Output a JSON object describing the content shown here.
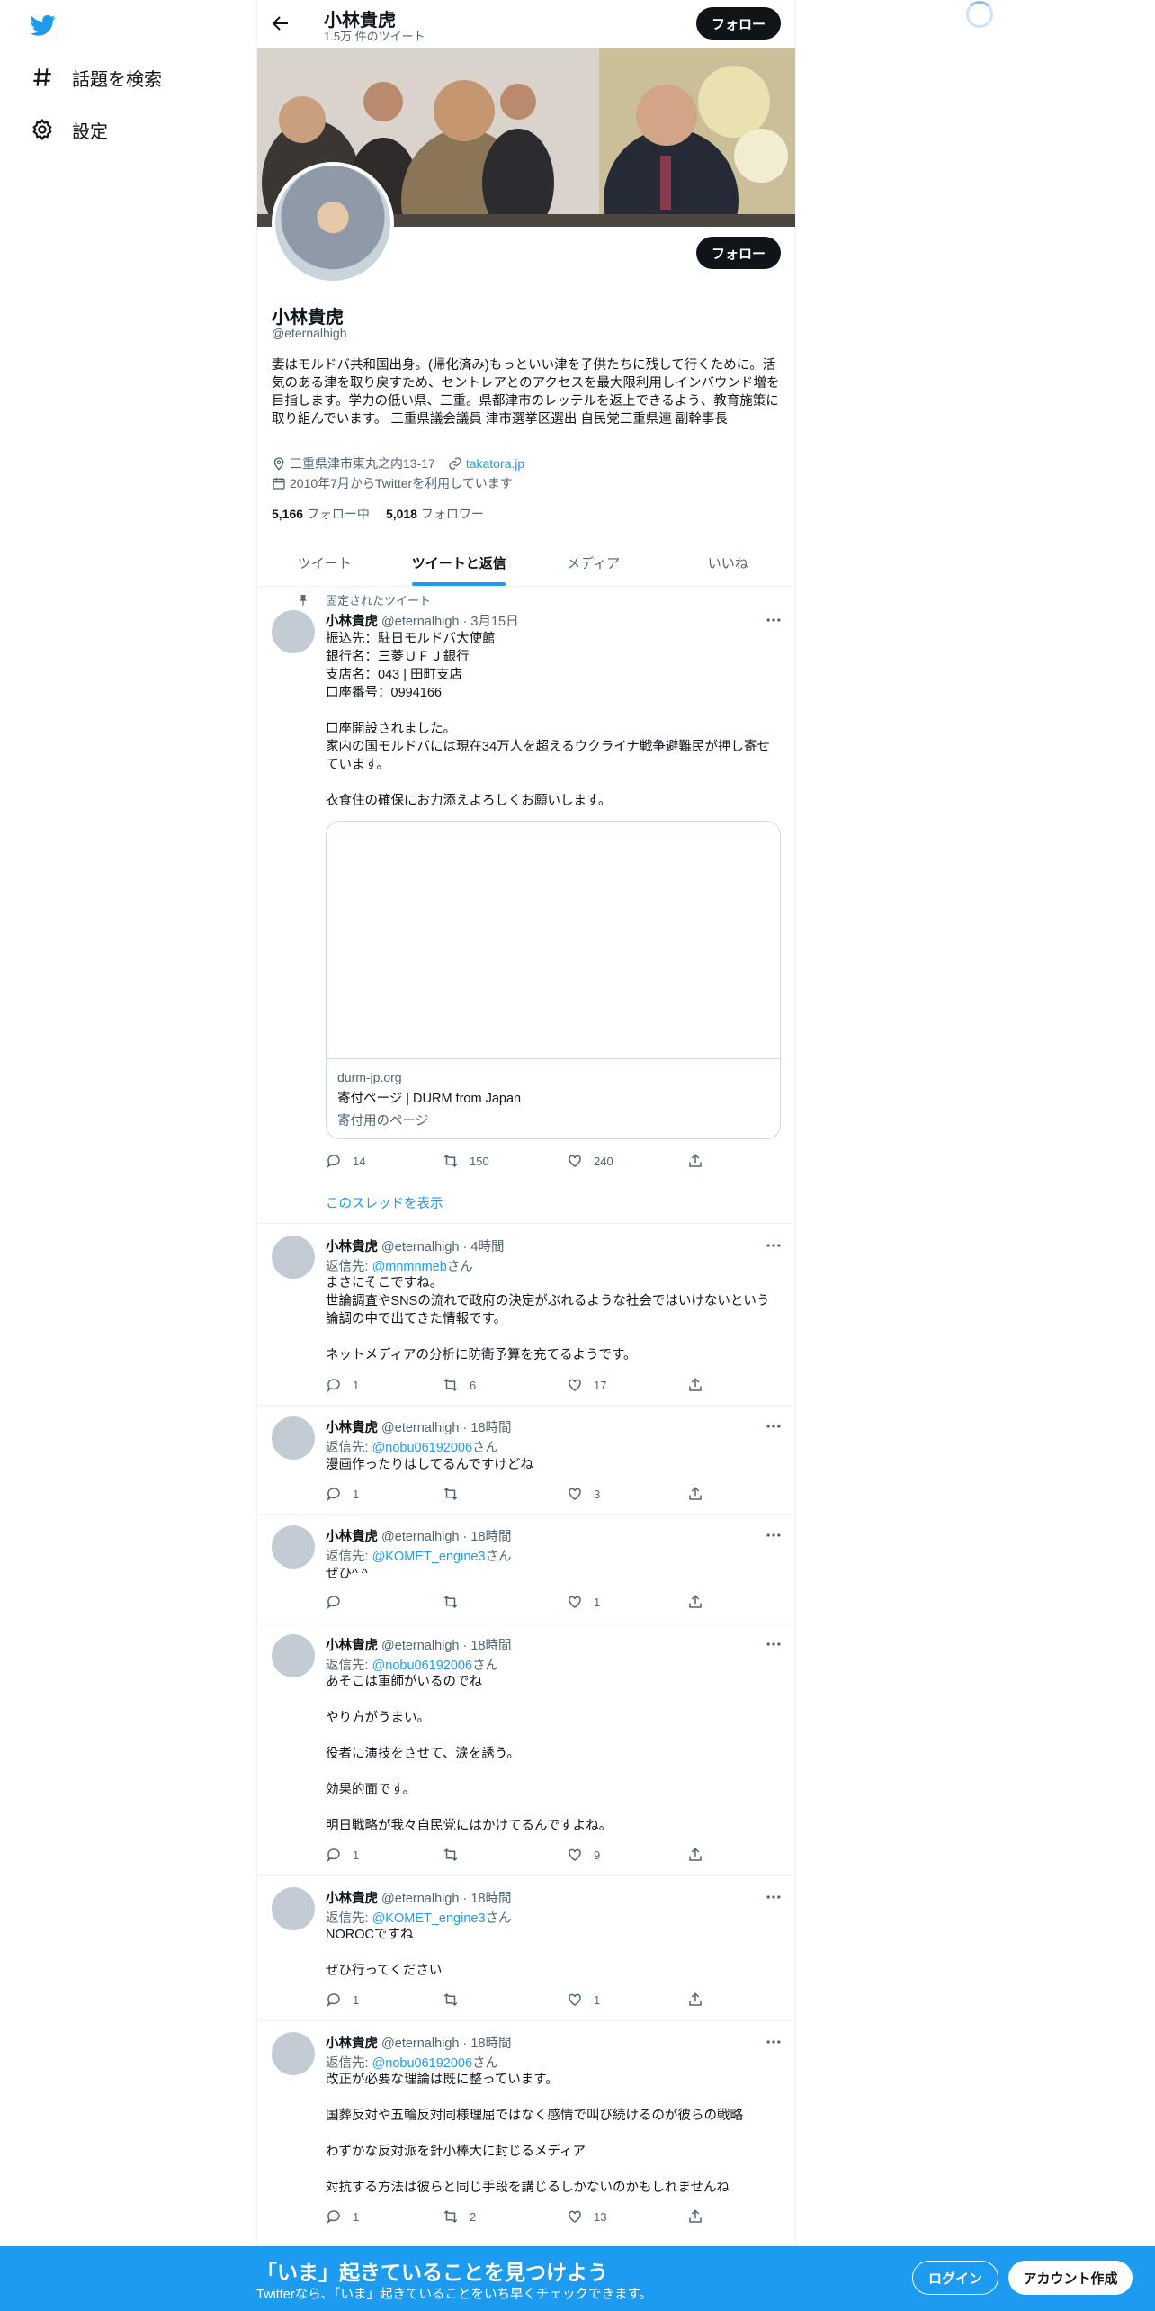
{
  "nav": {
    "explore_label": "話題を検索",
    "settings_label": "設定"
  },
  "topbar": {
    "name": "小林貴虎",
    "tweet_count": "1.5万 件のツイート",
    "follow_label": "フォロー"
  },
  "profile": {
    "name": "小林貴虎",
    "handle": "@eternalhigh",
    "follow_label": "フォロー",
    "bio": "妻はモルドバ共和国出身。(帰化済み)もっといい津を子供たちに残して行くために。活気のある津を取り戻すため、セントレアとのアクセスを最大限利用しインバウンド増を目指します。学力の低い県、三重。県都津市のレッテルを返上できるよう、教育施策に取り組んでいます。 三重県議会議員 津市選挙区選出 自民党三重県連 副幹事長",
    "location": "三重県津市東丸之内13-17",
    "website": "takatora.jp",
    "joined": "2010年7月からTwitterを利用しています",
    "following_count": "5,166",
    "following_label": "フォロー中",
    "followers_count": "5,018",
    "followers_label": "フォロワー"
  },
  "tabs": [
    "ツイート",
    "ツイートと返信",
    "メディア",
    "いいね"
  ],
  "pinned_label": "固定されたツイート",
  "tweets": [
    {
      "name": "小林貴虎",
      "handle": "@eternalhigh",
      "time": "· 3月15日",
      "text": "振込先：駐日モルドバ大使館\n銀行名：三菱ＵＦＪ銀行\n支店名：043 | 田町支店\n口座番号：0994166\n\n口座開設されました。\n家内の国モルドバには現在34万人を超えるウクライナ戦争避難民が押し寄せています。\n\n衣食住の確保にお力添えよろしくお願いします。",
      "card": {
        "domain": "durm-jp.org",
        "title": "寄付ページ | DURM from Japan",
        "desc": "寄付用のページ"
      },
      "reply": "14",
      "retweet": "150",
      "like": "240",
      "show_thread": "このスレッドを表示"
    },
    {
      "name": "小林貴虎",
      "handle": "@eternalhigh",
      "time": "· 4時間",
      "reply_prefix": "返信先: ",
      "reply_user": "@mnmnmeb",
      "reply_suffix": "さん",
      "text": "まさにそこですね。\n世論調査やSNSの流れで政府の決定がぶれるような社会ではいけないという論調の中で出てきた情報です。\n\nネットメディアの分析に防衛予算を充てるようです。",
      "reply": "1",
      "retweet": "6",
      "like": "17"
    },
    {
      "name": "小林貴虎",
      "handle": "@eternalhigh",
      "time": "· 18時間",
      "reply_prefix": "返信先: ",
      "reply_user": "@nobu06192006",
      "reply_suffix": "さん",
      "text": "漫画作ったりはしてるんですけどね",
      "reply": "1",
      "retweet": "",
      "like": "3"
    },
    {
      "name": "小林貴虎",
      "handle": "@eternalhigh",
      "time": "· 18時間",
      "reply_prefix": "返信先: ",
      "reply_user": "@KOMET_engine3",
      "reply_suffix": "さん",
      "text": "ぜひ^ ^",
      "reply": "",
      "retweet": "",
      "like": "1"
    },
    {
      "name": "小林貴虎",
      "handle": "@eternalhigh",
      "time": "· 18時間",
      "reply_prefix": "返信先: ",
      "reply_user": "@nobu06192006",
      "reply_suffix": "さん",
      "text": "あそこは軍師がいるのでね\n\nやり方がうまい。\n\n役者に演技をさせて、涙を誘う。\n\n効果的面です。\n\n明日戦略が我々自民党にはかけてるんですよね。",
      "reply": "1",
      "retweet": "",
      "like": "9"
    },
    {
      "name": "小林貴虎",
      "handle": "@eternalhigh",
      "time": "· 18時間",
      "reply_prefix": "返信先: ",
      "reply_user": "@KOMET_engine3",
      "reply_suffix": "さん",
      "text": "NOROCですね\n\nぜひ行ってください",
      "reply": "1",
      "retweet": "",
      "like": "1"
    },
    {
      "name": "小林貴虎",
      "handle": "@eternalhigh",
      "time": "· 18時間",
      "reply_prefix": "返信先: ",
      "reply_user": "@nobu06192006",
      "reply_suffix": "さん",
      "text": "改正が必要な理論は既に整っています。\n\n国葬反対や五輪反対同様理屈ではなく感情で叫び続けるのが彼らの戦略\n\nわずかな反対派を針小棒大に封じるメディア\n\n対抗する方法は彼らと同じ手段を講じるしかないのかもしれませんね",
      "reply": "1",
      "retweet": "2",
      "like": "13"
    }
  ],
  "bottom": {
    "title": "「いま」起きていることを見つけよう",
    "subtitle": "Twitterなら、「いま」起きていることをいち早くチェックできます。",
    "login": "ログイン",
    "signup": "アカウント作成"
  },
  "colors": {
    "accent": "#1d9bf0",
    "text": "#0f1419",
    "muted": "#536471"
  }
}
